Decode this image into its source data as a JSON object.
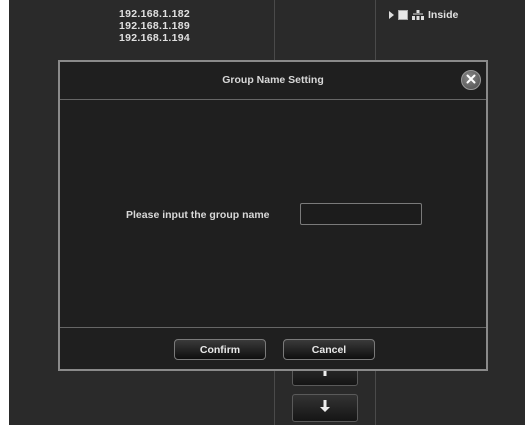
{
  "ip_list": [
    "192.168.1.182",
    "192.168.1.189",
    "192.168.1.194"
  ],
  "tree": {
    "label": "Inside",
    "icon": "network-icon"
  },
  "dialog": {
    "title": "Group Name Setting",
    "label": "Please input the group name",
    "input_value": "",
    "input_placeholder": "",
    "confirm_label": "Confirm",
    "cancel_label": "Cancel"
  },
  "icons": {
    "close": "close-icon",
    "move_up": "arrow-up-icon",
    "move_down": "arrow-down-icon",
    "expand": "triangle-right-icon",
    "checkbox": "checkbox-icon"
  },
  "colors": {
    "background": "#2a2a2a",
    "dialog_background": "#1f1f1f",
    "dialog_border": "#8a8a8a",
    "text": "#d8d8d8"
  }
}
